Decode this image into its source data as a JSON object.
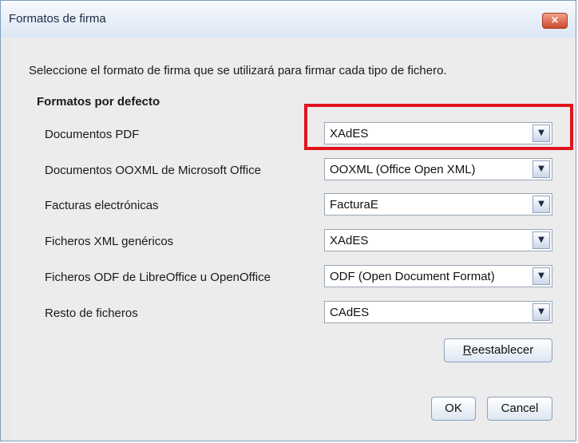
{
  "window": {
    "title": "Formatos de firma",
    "close_label": "×"
  },
  "instructions": "Seleccione el formato de firma que se utilizará para firmar cada tipo de fichero.",
  "section_title": "Formatos por defecto",
  "rows": [
    {
      "label": "Documentos PDF",
      "value": "XAdES"
    },
    {
      "label": "Documentos OOXML de Microsoft Office",
      "value": "OOXML (Office Open XML)"
    },
    {
      "label": "Facturas electrónicas",
      "value": "FacturaE"
    },
    {
      "label": "Ficheros XML genéricos",
      "value": "XAdES"
    },
    {
      "label": "Ficheros ODF de LibreOffice u OpenOffice",
      "value": "ODF (Open Document Format)"
    },
    {
      "label": "Resto de ficheros",
      "value": "CAdES"
    }
  ],
  "buttons": {
    "reset_mnemonic": "R",
    "reset_rest": "eestablecer",
    "ok": "OK",
    "cancel": "Cancel"
  },
  "colors": {
    "highlight": "#e1141e"
  },
  "icons": {
    "dropdown": "chevron-down-icon"
  }
}
